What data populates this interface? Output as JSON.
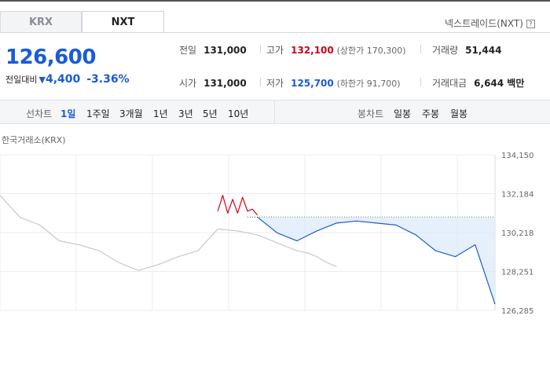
{
  "tabs": [
    {
      "label": "KRX",
      "selected": false
    },
    {
      "label": "NXT",
      "selected": true
    }
  ],
  "nxt_link": "넥스트레이드(NXT)",
  "help_label": "?",
  "price": {
    "current": "126,600",
    "change_label": "전일대비",
    "change_arrow": "▼",
    "change_amount": "4,400",
    "change_percent": "-3.36%"
  },
  "stats": {
    "prev_close": {
      "label": "전일",
      "value": "131,000"
    },
    "high": {
      "label": "고가",
      "value": "132,100",
      "limit": "(상한가 170,300)"
    },
    "volume": {
      "label": "거래량",
      "value": "51,444"
    },
    "open": {
      "label": "시가",
      "value": "131,000"
    },
    "low": {
      "label": "저가",
      "value": "125,700",
      "limit": "(하한가 91,700)"
    },
    "amount": {
      "label": "거래대금",
      "value": "6,644 백만"
    }
  },
  "line_chart_controls": {
    "label": "선차트",
    "periods": [
      {
        "label": "1일",
        "selected": true
      },
      {
        "label": "1주일",
        "selected": false
      },
      {
        "label": "3개월",
        "selected": false
      },
      {
        "label": "1년",
        "selected": false
      },
      {
        "label": "3년",
        "selected": false
      },
      {
        "label": "5년",
        "selected": false
      },
      {
        "label": "10년",
        "selected": false
      }
    ]
  },
  "candle_chart_controls": {
    "label": "봉차트",
    "periods": [
      {
        "label": "일봉"
      },
      {
        "label": "주봉"
      },
      {
        "label": "월봉"
      }
    ]
  },
  "chart_title": "한국거래소(KRX)",
  "colors": {
    "accent_blue": "#1a5bd6",
    "up_red": "#d0021b",
    "gray_line": "#c8c8c8",
    "fill_blue": "#dce9fb"
  },
  "chart_data": {
    "type": "line",
    "title": "한국거래소(KRX)",
    "y_ticks": [
      "134,150",
      "132,184",
      "130,218",
      "128,251",
      "126,285"
    ],
    "ylim": [
      126285,
      134150
    ],
    "reference_price": 131000,
    "grid": true,
    "series": [
      {
        "name": "",
        "color": "gray",
        "x": [
          0,
          0.04,
          0.08,
          0.12,
          0.16,
          0.2,
          0.24,
          0.28,
          0.32,
          0.36,
          0.4,
          0.44
        ],
        "values": [
          132100,
          131000,
          130600,
          129800,
          129600,
          129300,
          128700,
          128300,
          128600,
          129000,
          129300,
          130400
        ]
      },
      {
        "name": "",
        "color": "gray",
        "x": [
          0.44,
          0.48,
          0.52,
          0.56,
          0.6,
          0.62,
          0.64,
          0.66,
          0.68
        ],
        "values": [
          130400,
          130300,
          130100,
          129700,
          129300,
          129200,
          129000,
          128700,
          128500
        ]
      },
      {
        "name": "",
        "color": "red",
        "x": [
          0.44,
          0.45,
          0.46,
          0.47,
          0.48,
          0.49,
          0.5,
          0.51,
          0.52
        ],
        "values": [
          131300,
          132100,
          131200,
          131900,
          131200,
          132000,
          131300,
          131400,
          131100
        ]
      },
      {
        "name": "",
        "color": "blue",
        "x": [
          0.52,
          0.56,
          0.6,
          0.64,
          0.68,
          0.72,
          0.76,
          0.8,
          0.84,
          0.88,
          0.92,
          0.96,
          1.0
        ],
        "values": [
          131000,
          130200,
          129800,
          130300,
          130700,
          130800,
          130700,
          130600,
          130100,
          129300,
          129000,
          129600,
          126600
        ]
      }
    ]
  }
}
